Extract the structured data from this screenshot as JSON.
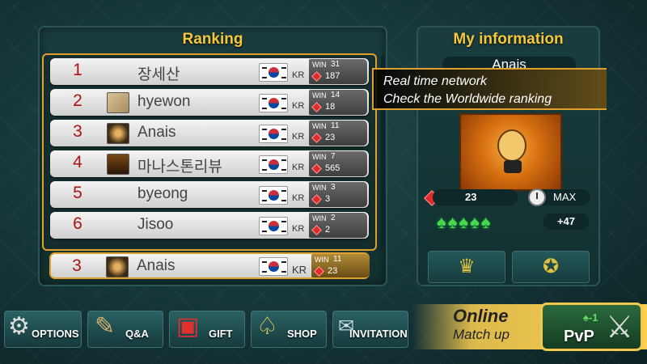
{
  "ranking": {
    "title": "Ranking",
    "rows": [
      {
        "rank": "1",
        "name": "장세산",
        "country": "KR",
        "win_label": "WIN",
        "wins": "31",
        "gems": "187",
        "avatar": "none"
      },
      {
        "rank": "2",
        "name": "hyewon",
        "country": "KR",
        "win_label": "WIN",
        "wins": "14",
        "gems": "18",
        "avatar": "photo"
      },
      {
        "rank": "3",
        "name": "Anais",
        "country": "KR",
        "win_label": "WIN",
        "wins": "11",
        "gems": "23",
        "avatar": "character"
      },
      {
        "rank": "4",
        "name": "마나스톤리뷰",
        "country": "KR",
        "win_label": "WIN",
        "wins": "7",
        "gems": "565",
        "avatar": "emblem"
      },
      {
        "rank": "5",
        "name": "byeong",
        "country": "KR",
        "win_label": "WIN",
        "wins": "3",
        "gems": "3",
        "avatar": "none"
      },
      {
        "rank": "6",
        "name": "Jisoo",
        "country": "KR",
        "win_label": "WIN",
        "wins": "2",
        "gems": "2",
        "avatar": "none"
      }
    ],
    "my_row": {
      "rank": "3",
      "name": "Anais",
      "country": "KR",
      "win_label": "WIN",
      "wins": "11",
      "gems": "23"
    }
  },
  "tooltip": {
    "line1": "Real time network",
    "line2": "Check the Worldwide ranking"
  },
  "my_info": {
    "title": "My information",
    "name": "Anais",
    "gems": "23",
    "time": "MAX",
    "spades_bonus": "+47",
    "spade_count": 5
  },
  "bottom_bar": {
    "options": "OPTIONS",
    "qna": "Q&A",
    "gift": "GIFT",
    "shop": "SHOP",
    "invitation": "INVITATION",
    "online_line1": "Online",
    "online_line2": "Match up",
    "pvp": "PvP",
    "pvp_cost": "-1"
  },
  "colors": {
    "accent": "#f6c93c",
    "rank_number": "#b01212",
    "panel_border": "#e0a030",
    "spade": "#4cd64c"
  }
}
